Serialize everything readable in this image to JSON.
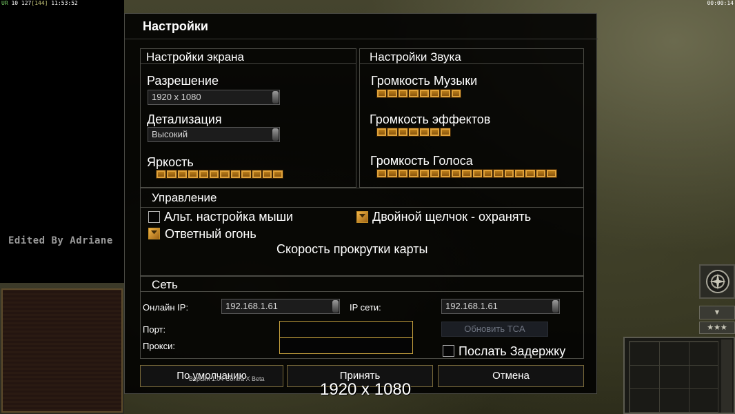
{
  "hud": {
    "top_left_prefix": "UR",
    "top_left_stats": "10 127",
    "top_left_count": "[144]",
    "top_left_time": "11:53:52",
    "top_right_timer": "00:00:14",
    "watermark": "Edited By Adriane",
    "stars": "★★★",
    "arrow": "▼"
  },
  "dialog": {
    "title": "Настройки",
    "display": {
      "title": "Настройки экрана",
      "resolution_label": "Разрешение",
      "resolution_value": "1920 x 1080",
      "detail_label": "Детализация",
      "detail_value": "Высокий",
      "brightness_label": "Яркость",
      "brightness_level": 12
    },
    "sound": {
      "title": "Настройки Звука",
      "music_label": "Громкость Музыки",
      "music_level": 8,
      "effects_label": "Громкость эффектов",
      "effects_level": 7,
      "voice_label": "Громкость Голоса",
      "voice_level": 17
    },
    "controls": {
      "title": "Управление",
      "alt_mouse_label": "Альт. настройка мыши",
      "alt_mouse_checked": false,
      "double_click_label": "Двойной щелчок - охранять",
      "double_click_checked": true,
      "return_fire_label": "Ответный огонь",
      "return_fire_checked": true,
      "scroll_speed_label": "Скорость прокрутки карты"
    },
    "network": {
      "title": "Сеть",
      "online_ip_label": "Онлайн IP:",
      "online_ip_value": "192.168.1.61",
      "network_ip_label": "IP сети:",
      "network_ip_value": "192.168.1.61",
      "port_label": "Порт:",
      "proxy_label": "Прокси:",
      "update_tca_label": "Обновить TCA",
      "send_delay_label": "Послать Задержку",
      "send_delay_checked": false
    },
    "buttons": {
      "default": "По умолчанию",
      "accept": "Принять",
      "cancel": "Отмена"
    },
    "version": "Версия 1.04 Contra X Beta",
    "overlay_resolution": "1920 x 1080"
  },
  "colors": {
    "accent_gold": "#c9a33e",
    "slider_orange": "#c8881c",
    "dialog_bg": "#000000"
  }
}
